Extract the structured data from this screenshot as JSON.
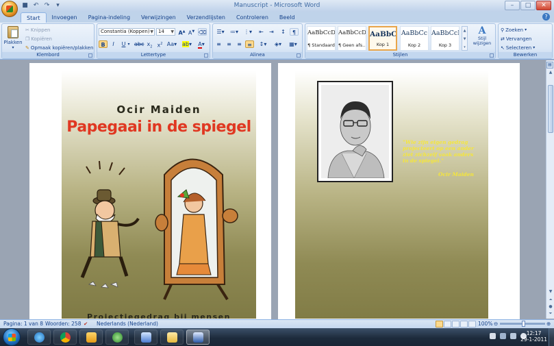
{
  "window": {
    "title": "Manuscript - Microsoft Word"
  },
  "tabs": [
    "Start",
    "Invoegen",
    "Pagina-indeling",
    "Verwijzingen",
    "Verzendlijsten",
    "Controleren",
    "Beeld"
  ],
  "ribbon": {
    "klembord": {
      "label": "Klembord",
      "paste": "Plakken",
      "cut": "Knippen",
      "copy": "Kopiëren",
      "format_painter": "Opmaak kopiëren/plakken"
    },
    "lettertype": {
      "label": "Lettertype",
      "font_name": "Constantia (Koppen)",
      "font_size": "14"
    },
    "alinea": {
      "label": "Alinea"
    },
    "stijlen": {
      "label": "Stijlen",
      "tiles": [
        {
          "sample": "AaBbCcD",
          "name": "¶ Standaard"
        },
        {
          "sample": "AaBbCcD",
          "name": "¶ Geen afs..."
        },
        {
          "sample": "AaBbC",
          "name": "Kop 1"
        },
        {
          "sample": "AaBbCc",
          "name": "Kop 2"
        },
        {
          "sample": "AaBbCcI",
          "name": "Kop 3"
        }
      ],
      "change_styles": "Stijl wijzigen"
    },
    "bewerken": {
      "label": "Bewerken",
      "find": "Zoeken",
      "replace": "Vervangen",
      "select": "Selecteren"
    }
  },
  "document": {
    "cover_author": "Ocir Maiden",
    "cover_title": "Papegaai in de spiegel",
    "cover_subtitle": "Projectiegedrag bij mensen",
    "back_quote": "\"Wie zijn eigen gedrag projecteert op een ander ziet zichzelf vaak anders in de spiegel.\"",
    "back_author": "Ocir Maiden"
  },
  "status": {
    "page": "Pagina: 1 van 8",
    "words": "Woorden: 258",
    "language": "Nederlands (Nederland)",
    "zoom": "100%"
  },
  "taskbar": {
    "time": "12:17",
    "date": "29-1-2011"
  },
  "colors": {
    "title_red": "#e03822",
    "quote_yellow": "#f5e63a",
    "ribbon_blue": "#15428b"
  }
}
